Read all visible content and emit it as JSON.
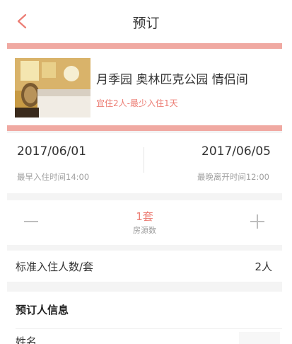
{
  "header": {
    "title": "预订",
    "back_icon": "chevron-left-icon"
  },
  "room": {
    "name": "月季园 奥林匹克公园 情侣间",
    "subtitle": "宜住2人-最少入住1天",
    "image": "hotel-room-photo"
  },
  "dates": {
    "check_in": "2017/06/01",
    "check_in_note": "最早入住时间14:00",
    "check_out": "2017/06/05",
    "check_out_note": "最晚离开时间12:00"
  },
  "rooms": {
    "count": "1套",
    "label": "房源数"
  },
  "guests": {
    "label": "标准入住人数/套",
    "value": "2人"
  },
  "booker": {
    "title": "预订人信息",
    "name_label": "姓名"
  },
  "colors": {
    "accent": "#ec7d74",
    "bar": "#f0a9a2",
    "gap": "#f4f4f4"
  }
}
